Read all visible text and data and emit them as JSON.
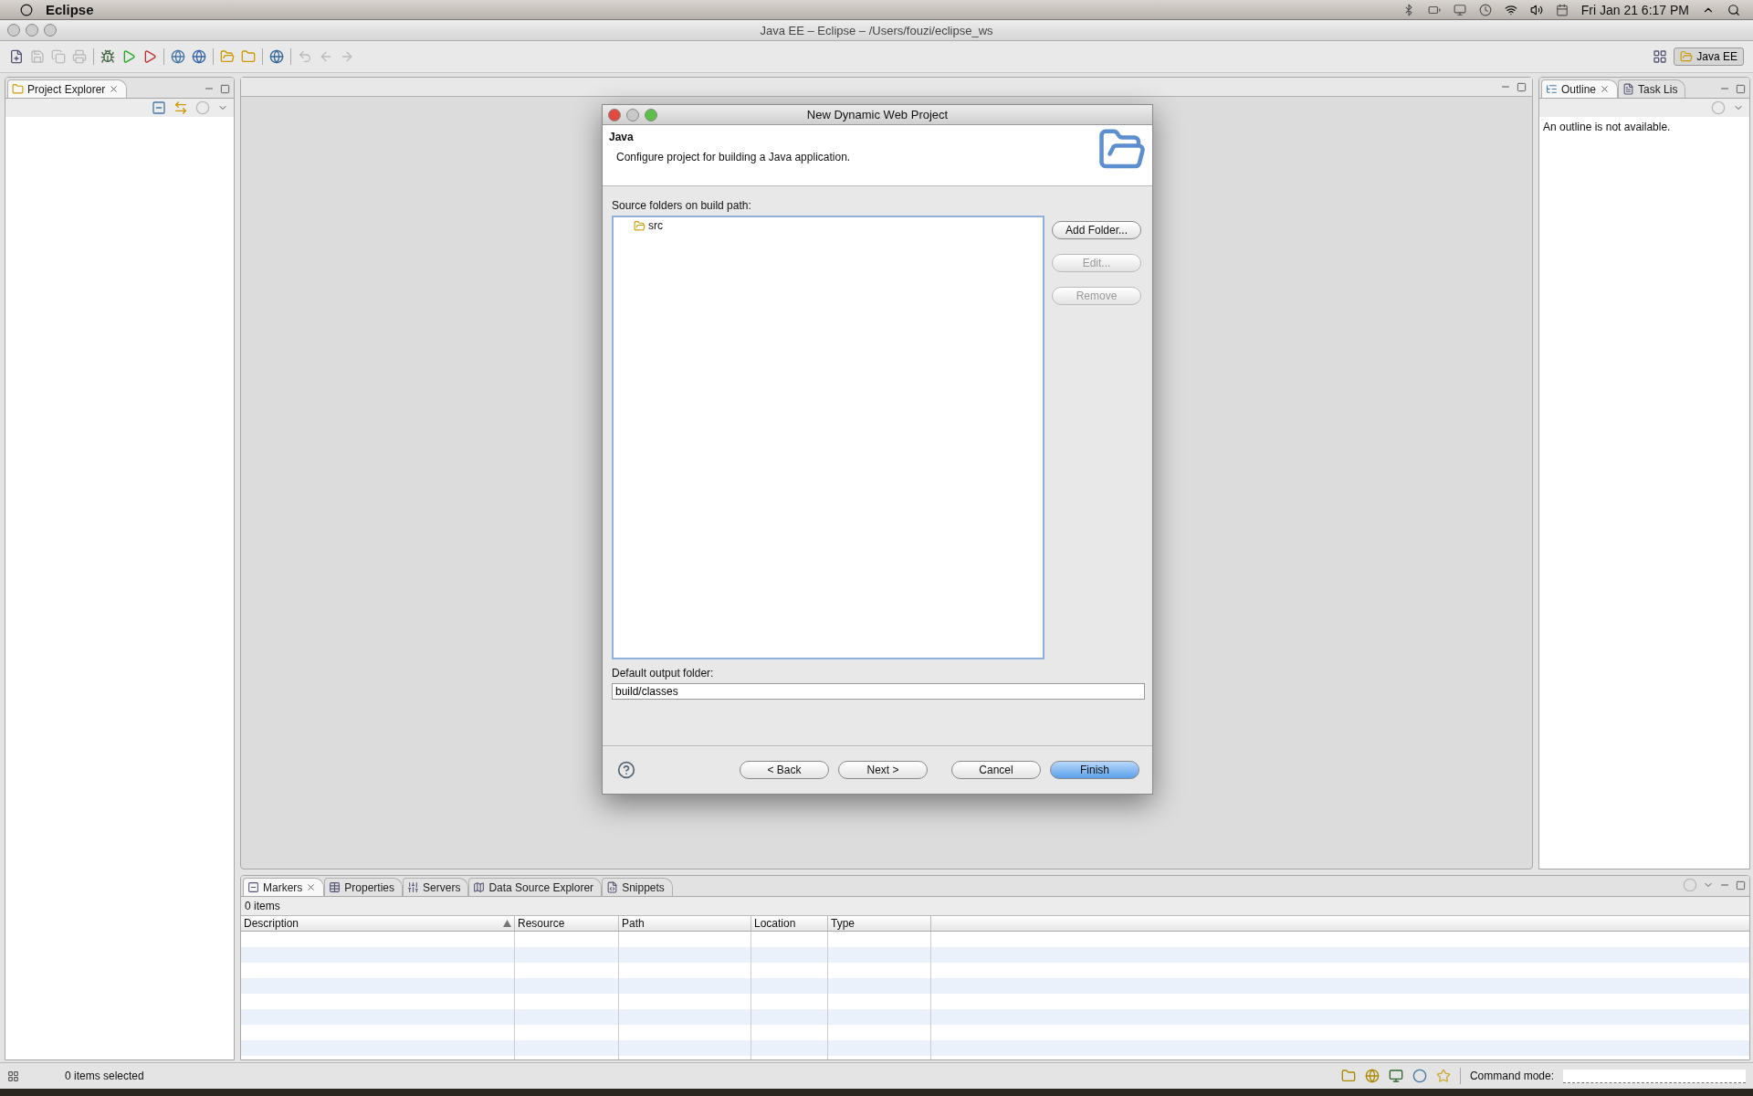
{
  "menu_bar": {
    "app_name": "Eclipse",
    "clock": "Fri Jan 21  6:17 PM"
  },
  "window": {
    "title": "Java EE – Eclipse – /Users/fouzi/eclipse_ws"
  },
  "perspective": {
    "label": "Java EE",
    "selected": true
  },
  "left_panel": {
    "tabs": [
      {
        "label": "Project Explorer",
        "selected": true
      }
    ]
  },
  "right_panel": {
    "tabs": [
      {
        "label": "Outline",
        "selected": true
      },
      {
        "label": "Task Lis",
        "selected": false
      }
    ],
    "message": "An outline is not available."
  },
  "dialog": {
    "title": "New Dynamic Web Project",
    "heading": "Java",
    "description": "Configure project for building a Java application.",
    "source_label": "Source folders on build path:",
    "source_folders": [
      {
        "name": "src",
        "selected": false
      }
    ],
    "side_buttons": [
      {
        "label": "Add Folder...",
        "disabled": false
      },
      {
        "label": "Edit...",
        "disabled": true
      },
      {
        "label": "Remove",
        "disabled": true
      }
    ],
    "output_label": "Default output folder:",
    "output_value": "build/classes",
    "buttons": [
      {
        "label": "< Back",
        "default": false
      },
      {
        "label": "Next >",
        "default": false
      },
      {
        "label": "Cancel",
        "default": false
      },
      {
        "label": "Finish",
        "default": true
      }
    ]
  },
  "bottom_panel": {
    "tabs": [
      {
        "label": "Markers",
        "selected": true
      },
      {
        "label": "Properties",
        "selected": false
      },
      {
        "label": "Servers",
        "selected": false
      },
      {
        "label": "Data Source Explorer",
        "selected": false
      },
      {
        "label": "Snippets",
        "selected": false
      }
    ],
    "count": "0 items",
    "columns": [
      {
        "label": "Description",
        "sorted": true
      },
      {
        "label": "Resource",
        "sorted": false
      },
      {
        "label": "Path",
        "sorted": false
      },
      {
        "label": "Location",
        "sorted": false
      },
      {
        "label": "Type",
        "sorted": false
      }
    ]
  },
  "status_bar": {
    "selection": "0 items selected",
    "command_label": "Command mode:"
  }
}
